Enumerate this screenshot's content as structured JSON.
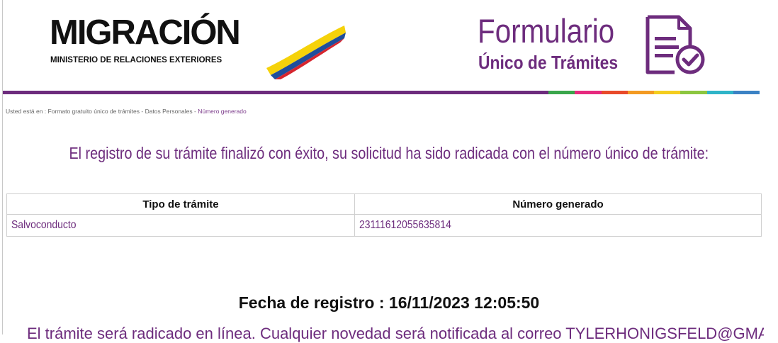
{
  "header": {
    "logo_left_text": "MIGRACIÓN",
    "logo_left_subtext": "MINISTERIO DE RELACIONES EXTERIORES",
    "logo_right_title": "Formulario",
    "logo_right_subtitle": "Único de Trámites",
    "brand_color": "#6d2c7d",
    "bar_segment_colors": [
      "#3aa64b",
      "#e6297e",
      "#e84a2a",
      "#f39a22",
      "#f4cd1e",
      "#8cc63f",
      "#2fb4c8",
      "#3b82c4"
    ]
  },
  "breadcrumb": {
    "prefix": "Usted está en : ",
    "items": [
      "Formato gratuito único de trámites",
      "Datos Personales"
    ],
    "separator": " - ",
    "current": "Número generado"
  },
  "message": {
    "text": "El registro de su trámite finalizó con éxito, su solicitud ha sido radicada con el número único de trámite:"
  },
  "table": {
    "headers": [
      "Tipo de trámite",
      "Número generado"
    ],
    "rows": [
      {
        "tipo": "Salvoconducto",
        "numero": "23111612055635814"
      }
    ]
  },
  "fecha": {
    "label": "Fecha de registro : ",
    "value": "16/11/2023 12:05:50"
  },
  "email_notice": {
    "text": "El trámite será radicado en línea. Cualquier novedad será notificada al correo TYLERHONIGSFELD@GMAIL.COM"
  }
}
